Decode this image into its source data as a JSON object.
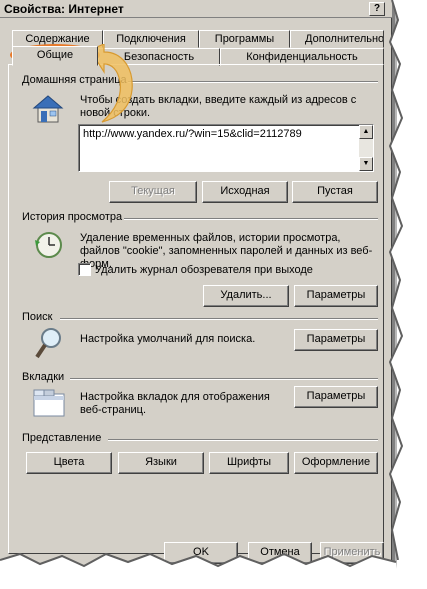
{
  "window": {
    "title": "Свойства: Интернет",
    "help_label": "?"
  },
  "tabs": {
    "row1": [
      "Содержание",
      "Подключения",
      "Программы",
      "Дополнительно"
    ],
    "row2": [
      "Общие",
      "Безопасность",
      "Конфиденциальность"
    ],
    "active": "Общие"
  },
  "home": {
    "title": "Домашняя страница",
    "description": "Чтобы создать вкладки, введите каждый из адресов с новой строки.",
    "url": "http://www.yandex.ru/?win=15&clid=2112789",
    "buttons": {
      "current": "Текущая",
      "default": "Исходная",
      "blank": "Пустая"
    }
  },
  "history": {
    "title": "История просмотра",
    "description": "Удаление временных файлов, истории просмотра, файлов \"cookie\", запомненных паролей и данных из веб-форм.",
    "checkbox_label": "Удалить журнал обозревателя при выходе",
    "checkbox_checked": false,
    "buttons": {
      "delete": "Удалить...",
      "settings": "Параметры"
    }
  },
  "search": {
    "title": "Поиск",
    "description": "Настройка умолчаний для поиска.",
    "button": "Параметры"
  },
  "tabs_group": {
    "title": "Вкладки",
    "description": "Настройка вкладок для отображения веб-страниц.",
    "button": "Параметры"
  },
  "appearance": {
    "title": "Представление",
    "buttons": {
      "colors": "Цвета",
      "languages": "Языки",
      "fonts": "Шрифты",
      "accessibility": "Оформление"
    }
  },
  "footer": {
    "ok": "OK",
    "cancel": "Отмена",
    "apply": "Применить"
  },
  "colors": {
    "accent": "#e87a2a",
    "dialog_bg": "#d4d0c8"
  },
  "icons": {
    "home": "house-icon",
    "history": "clock-refresh-icon",
    "search": "magnifier-icon",
    "tabs": "tabs-window-icon"
  }
}
